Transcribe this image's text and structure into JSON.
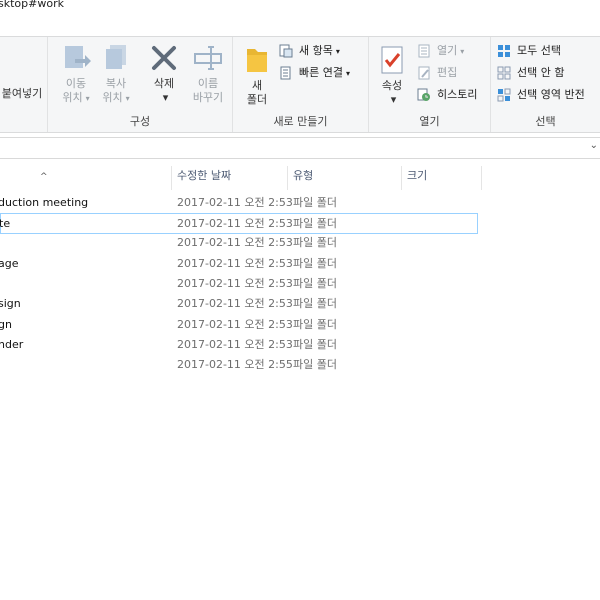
{
  "titlebar": {
    "path": "sktop#work"
  },
  "ribbon": {
    "groups": [
      {
        "label": "",
        "items": [
          {
            "label": "붙여넣기"
          }
        ]
      },
      {
        "label": "구성",
        "items": [
          {
            "label1": "이동",
            "label2": "위치"
          },
          {
            "label1": "복사",
            "label2": "위치"
          },
          {
            "label1": "삭제",
            "label2": ""
          },
          {
            "label1": "이름",
            "label2": "바꾸기"
          }
        ]
      },
      {
        "label": "새로 만들기",
        "items": [
          {
            "label1": "새",
            "label2": "폴더"
          },
          {
            "label": "새 항목"
          },
          {
            "label": "빠른 연결"
          }
        ]
      },
      {
        "label": "열기",
        "items": [
          {
            "label": "속성"
          },
          {
            "label": "열기"
          },
          {
            "label": "편집"
          },
          {
            "label": "히스토리"
          }
        ]
      },
      {
        "label": "선택",
        "items": [
          {
            "label": "모두 선택"
          },
          {
            "label": "선택 안 함"
          },
          {
            "label": "선택 영역 반전"
          }
        ]
      }
    ]
  },
  "columns": {
    "date": "수정한 날짜",
    "type": "유형",
    "size": "크기"
  },
  "rows": [
    {
      "name": "duction meeting",
      "date": "2017-02-11 오전 2:53",
      "type": "파일 폴더"
    },
    {
      "name": "te",
      "date": "2017-02-11 오전 2:53",
      "type": "파일 폴더"
    },
    {
      "name": "",
      "date": "2017-02-11 오전 2:53",
      "type": "파일 폴더"
    },
    {
      "name": "age",
      "date": "2017-02-11 오전 2:53",
      "type": "파일 폴더"
    },
    {
      "name": "",
      "date": "2017-02-11 오전 2:53",
      "type": "파일 폴더"
    },
    {
      "name": "sign",
      "date": "2017-02-11 오전 2:53",
      "type": "파일 폴더"
    },
    {
      "name": "gn",
      "date": "2017-02-11 오전 2:53",
      "type": "파일 폴더"
    },
    {
      "name": "nder",
      "date": "2017-02-11 오전 2:53",
      "type": "파일 폴더"
    },
    {
      "name": "",
      "date": "2017-02-11 오전 2:55",
      "type": "파일 폴더"
    }
  ],
  "colors": {
    "selection_border": "#99d1ff",
    "header_text": "#4c5a73",
    "folder": "#e8b633"
  }
}
